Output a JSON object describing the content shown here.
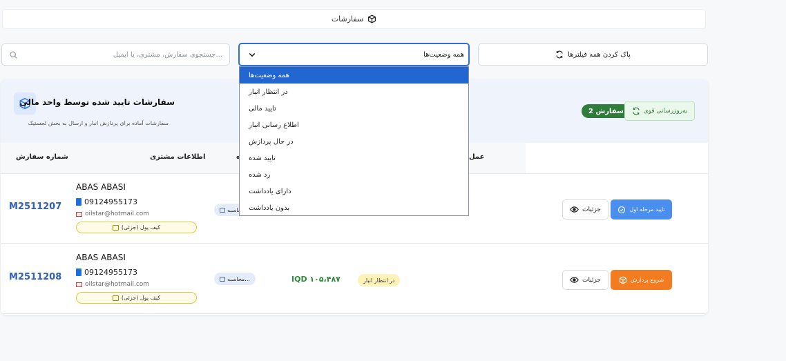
{
  "header": {
    "title": "سفارشات",
    "icon": "box-icon"
  },
  "filters": {
    "search_placeholder": "جستجوی سفارش، مشتری، یا ایمیل...",
    "status_selected": "همه وضعیت‌ها",
    "clear_label": "پاک کردن همه فیلترها"
  },
  "status_options": [
    "همه وضعیت‌ها",
    "در انتظار انبار",
    "تایید مالی",
    "اطلاع رسانی انبار",
    "در حال پردازش",
    "تایید شده",
    "رد شده",
    "دارای یادداشت",
    "بدون یادداشت"
  ],
  "panel": {
    "title": "سفارشات تایید شده توسط واحد مالی",
    "subtitle": "سفارشات آماده برای پردازش انبار و ارسال به بخش لجستیک",
    "count_badge": "2 سفارش",
    "refresh_label": "به‌روزرسانی قوی"
  },
  "table": {
    "headers": {
      "order_number": "شماره سفارش",
      "customer_info": "اطلاعات مشتری",
      "col3_partial": "ه",
      "actions_partial": "عمل"
    },
    "rows": [
      {
        "order_number": "M2511207",
        "customer_name": "ABAS ABASI",
        "phone": "09124955173",
        "email": "oilstar@hotmail.com",
        "wallet": "کیف پول (جزئی)",
        "calc": "محاسبه",
        "amount": "",
        "status": "",
        "details_label": "جزئیات",
        "action_label": "تایید مرحله اول",
        "action_color": "#4a8ff0"
      },
      {
        "order_number": "M2511208",
        "customer_name": "ABAS ABASI",
        "phone": "09124955173",
        "email": "oilstar@hotmail.com",
        "wallet": "کیف پول (جزئی)",
        "calc": "محاسبه...",
        "amount": "IQD ۱۰۵،۴۸۷",
        "status": "در انتظار انبار",
        "details_label": "جزئیات",
        "action_label": "شروع پردازش",
        "action_color": "#f47c20"
      }
    ]
  },
  "colors": {
    "accent": "#2166d1",
    "green_badge": "#2f7d3b",
    "order_link": "#2f5fb8",
    "approve_btn": "#4a8ff0",
    "process_btn": "#f47c20"
  }
}
